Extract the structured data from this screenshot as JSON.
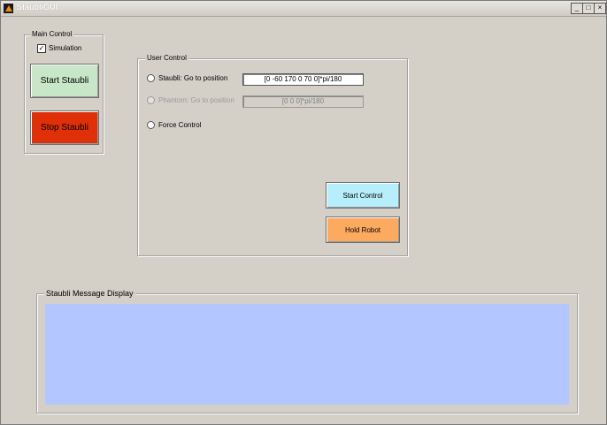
{
  "window": {
    "title": "StaubliGUI",
    "min_glyph": "_",
    "max_glyph": "□",
    "close_glyph": "×"
  },
  "main_control": {
    "title": "Main Control",
    "simulation_label": "Simulation",
    "simulation_checked": "✓",
    "start_label": "Start Staubli",
    "stop_label": "Stop Staubli"
  },
  "user_control": {
    "title": "User Control",
    "staubli_label": "Staubli: Go to position",
    "staubli_value": "[0 -60 170 0 70 0]*pi/180",
    "phantom_label": "Phantom: Go to position",
    "phantom_value": "[0 0 0]*pi/180",
    "force_label": "Force Control",
    "start_control_label": "Start Control",
    "hold_robot_label": "Hold Robot"
  },
  "message_display": {
    "title": "Staubli Message Display"
  },
  "colors": {
    "start_staubli": "#c8e6c8",
    "stop_staubli": "#e0300a",
    "start_control": "#b6eefc",
    "hold_robot": "#fcaa60",
    "message_bg": "#b3c6ff"
  }
}
